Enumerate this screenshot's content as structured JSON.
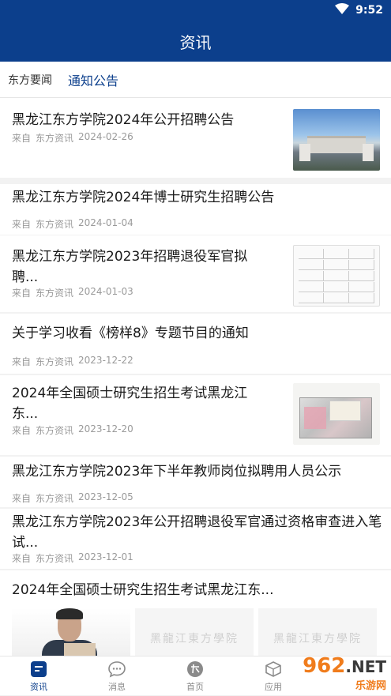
{
  "status_bar": {
    "time": "9:52"
  },
  "header": {
    "title": "资讯"
  },
  "tabs": [
    {
      "label": "东方要闻"
    },
    {
      "label": "通知公告"
    }
  ],
  "articles": [
    {
      "title": "黑龙江东方学院2024年公开招聘公告",
      "source_prefix": "来自",
      "source": "东方资讯",
      "date": "2024-02-26"
    },
    {
      "title": "黑龙江东方学院2024年博士研究生招聘公告",
      "source_prefix": "来自",
      "source": "东方资讯",
      "date": "2024-01-04"
    },
    {
      "title": "黑龙江东方学院2023年招聘退役军官拟聘...",
      "source_prefix": "来自",
      "source": "东方资讯",
      "date": "2024-01-03"
    },
    {
      "title": "关于学习收看《榜样8》专题节目的通知",
      "source_prefix": "来自",
      "source": "东方资讯",
      "date": "2023-12-22"
    },
    {
      "title": "2024年全国硕士研究生招生考试黑龙江东...",
      "source_prefix": "来自",
      "source": "东方资讯",
      "date": "2023-12-20"
    },
    {
      "title": "黑龙江东方学院2023年下半年教师岗位拟聘用人员公示",
      "source_prefix": "来自",
      "source": "东方资讯",
      "date": "2023-12-05"
    },
    {
      "title": "黑龙江东方学院2023年公开招聘退役军官通过资格审查进入笔试...",
      "source_prefix": "来自",
      "source": "东方资讯",
      "date": "2023-12-01"
    },
    {
      "title": "2024年全国硕士研究生招生考试黑龙江东..."
    }
  ],
  "gallery_calligraphy": "黑龍江東方學院",
  "bottom_nav": [
    {
      "label": "资讯",
      "icon": "news-icon"
    },
    {
      "label": "消息",
      "icon": "chat-icon"
    },
    {
      "label": "首页",
      "icon": "home-logo-icon"
    },
    {
      "label": "应用",
      "icon": "apps-icon"
    }
  ],
  "watermark": {
    "big": "962",
    "net": ".NET",
    "small": "乐游网"
  },
  "colors": {
    "primary": "#0c3f8c",
    "meta": "#9a9a9a",
    "watermark": "#f07c1c"
  }
}
